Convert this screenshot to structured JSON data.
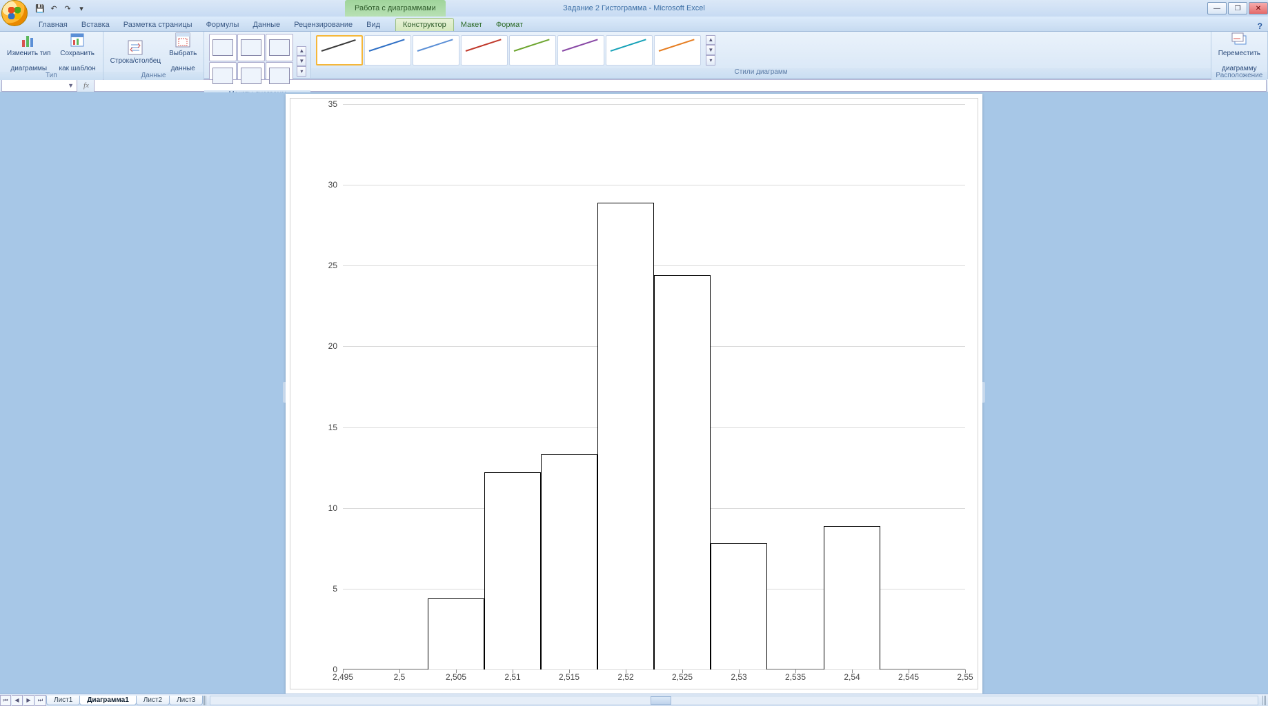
{
  "titlebar": {
    "doc_title": "Задание 2 Гистограмма - Microsoft Excel",
    "context_title": "Работа с диаграммами",
    "qat": {
      "save": "💾",
      "undo": "↶",
      "redo": "↷",
      "dd": "▾"
    },
    "win": {
      "min": "—",
      "max": "❐",
      "close": "✕"
    }
  },
  "tabs": {
    "home": "Главная",
    "insert": "Вставка",
    "layout": "Разметка страницы",
    "formulas": "Формулы",
    "data": "Данные",
    "review": "Рецензирование",
    "view": "Вид",
    "ctx_design": "Конструктор",
    "ctx_layout": "Макет",
    "ctx_format": "Формат",
    "help": "?"
  },
  "ribbon": {
    "type": {
      "change_type_l1": "Изменить тип",
      "change_type_l2": "диаграммы",
      "save_tmpl_l1": "Сохранить",
      "save_tmpl_l2": "как шаблон",
      "label": "Тип"
    },
    "data": {
      "switch": "Строка/столбец",
      "select_l1": "Выбрать",
      "select_l2": "данные",
      "label": "Данные"
    },
    "layouts": {
      "label": "Макеты диаграмм"
    },
    "styles": {
      "label": "Стили диаграмм",
      "colors": [
        "#3a3a3a",
        "#2e6fc5",
        "#2e6fc5",
        "#c0392b",
        "#6da52f",
        "#8848a5",
        "#1n",
        "#e67e22"
      ],
      "colors_fixed": [
        "#3a3a3a",
        "#2e6fc5",
        "#5b8fd6",
        "#c0392b",
        "#6da52f",
        "#8848a5",
        "#17a2b8",
        "#e67e22"
      ]
    },
    "location": {
      "move_l1": "Переместить",
      "move_l2": "диаграмму",
      "label": "Расположение"
    }
  },
  "formula_bar": {
    "name": "",
    "fx": "fx"
  },
  "sheettabs": {
    "s1": "Лист1",
    "s2": "Диаграмма1",
    "s3": "Лист2",
    "s4": "Лист3"
  },
  "chart_data": {
    "type": "bar",
    "title": "",
    "xlabel": "",
    "ylabel": "",
    "xlim": [
      2.495,
      2.55
    ],
    "ylim": [
      0,
      35
    ],
    "y_ticks": [
      0,
      5,
      10,
      15,
      20,
      25,
      30,
      35
    ],
    "x_ticks": [
      "2,495",
      "2,5",
      "2,505",
      "2,51",
      "2,515",
      "2,52",
      "2,525",
      "2,53",
      "2,535",
      "2,54",
      "2,545",
      "2,55"
    ],
    "bins": [
      {
        "x0": 2.5025,
        "x1": 2.5075,
        "y": 4.4
      },
      {
        "x0": 2.5075,
        "x1": 2.5125,
        "y": 12.2
      },
      {
        "x0": 2.5125,
        "x1": 2.5175,
        "y": 13.3
      },
      {
        "x0": 2.5175,
        "x1": 2.5225,
        "y": 28.9
      },
      {
        "x0": 2.5225,
        "x1": 2.5275,
        "y": 24.4
      },
      {
        "x0": 2.5275,
        "x1": 2.5325,
        "y": 7.8
      },
      {
        "x0": 2.5375,
        "x1": 2.5425,
        "y": 8.9
      }
    ]
  }
}
